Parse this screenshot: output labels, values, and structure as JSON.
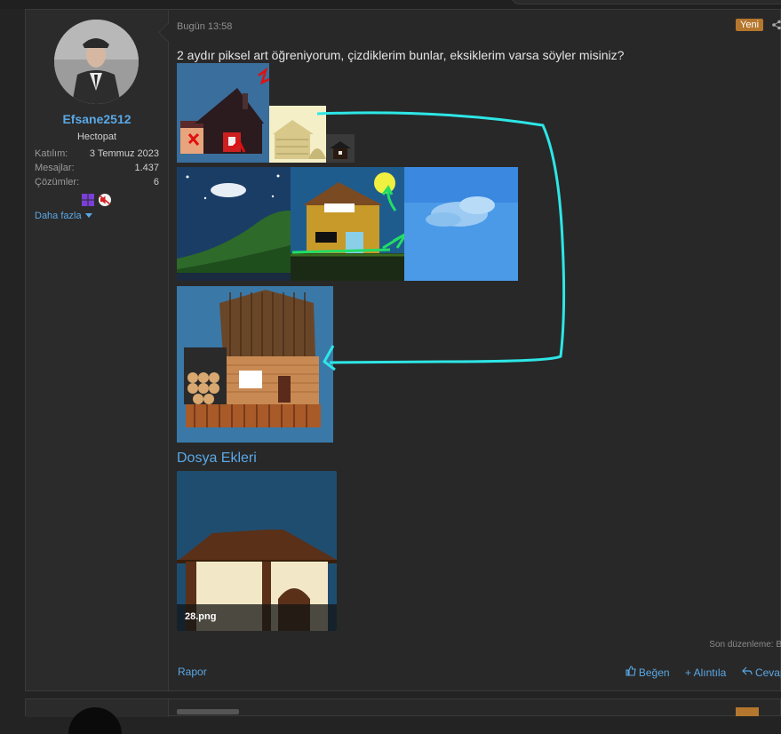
{
  "post": {
    "user": {
      "name": "Efsane2512",
      "title": "Hectopat",
      "stats": [
        {
          "label": "Katılım:",
          "value": "3 Temmuz 2023"
        },
        {
          "label": "Mesajlar:",
          "value": "1.437"
        },
        {
          "label": "Çözümler:",
          "value": "6"
        }
      ],
      "more_label": "Daha fazla",
      "badges": [
        "windows-icon",
        "muted-speaker-icon"
      ]
    },
    "date": "Bugün 13:58",
    "new_badge": "Yeni",
    "message": "2 aydır piksel art öğreniyorum, çizdiklerim bunlar, eksiklerim varsa söyler misiniz?",
    "attachments_title": "Dosya Ekleri",
    "attachment": {
      "filename": "28.png"
    },
    "edited": "Son düzenleme: B",
    "report_label": "Rapor",
    "actions": {
      "like": "Beğen",
      "quote": "+ Alıntıla",
      "reply": "Cevapla"
    }
  },
  "colors": {
    "accent": "#5aa8e6",
    "new_badge": "#b5772d",
    "annotation_cyan": "#2ee6e6",
    "annotation_green": "#22dd66",
    "annotation_red": "#e01010"
  }
}
